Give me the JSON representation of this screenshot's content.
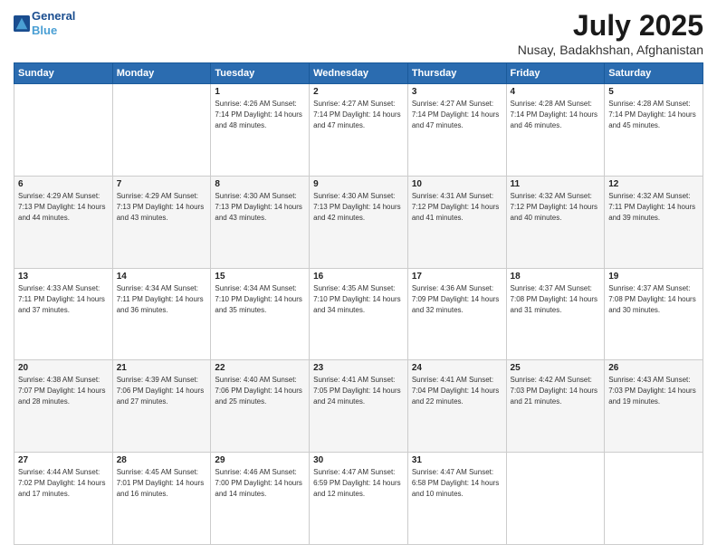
{
  "header": {
    "logo_line1": "General",
    "logo_line2": "Blue",
    "title": "July 2025",
    "subtitle": "Nusay, Badakhshan, Afghanistan"
  },
  "weekdays": [
    "Sunday",
    "Monday",
    "Tuesday",
    "Wednesday",
    "Thursday",
    "Friday",
    "Saturday"
  ],
  "weeks": [
    [
      {
        "day": "",
        "info": ""
      },
      {
        "day": "",
        "info": ""
      },
      {
        "day": "1",
        "info": "Sunrise: 4:26 AM\nSunset: 7:14 PM\nDaylight: 14 hours and 48 minutes."
      },
      {
        "day": "2",
        "info": "Sunrise: 4:27 AM\nSunset: 7:14 PM\nDaylight: 14 hours and 47 minutes."
      },
      {
        "day": "3",
        "info": "Sunrise: 4:27 AM\nSunset: 7:14 PM\nDaylight: 14 hours and 47 minutes."
      },
      {
        "day": "4",
        "info": "Sunrise: 4:28 AM\nSunset: 7:14 PM\nDaylight: 14 hours and 46 minutes."
      },
      {
        "day": "5",
        "info": "Sunrise: 4:28 AM\nSunset: 7:14 PM\nDaylight: 14 hours and 45 minutes."
      }
    ],
    [
      {
        "day": "6",
        "info": "Sunrise: 4:29 AM\nSunset: 7:13 PM\nDaylight: 14 hours and 44 minutes."
      },
      {
        "day": "7",
        "info": "Sunrise: 4:29 AM\nSunset: 7:13 PM\nDaylight: 14 hours and 43 minutes."
      },
      {
        "day": "8",
        "info": "Sunrise: 4:30 AM\nSunset: 7:13 PM\nDaylight: 14 hours and 43 minutes."
      },
      {
        "day": "9",
        "info": "Sunrise: 4:30 AM\nSunset: 7:13 PM\nDaylight: 14 hours and 42 minutes."
      },
      {
        "day": "10",
        "info": "Sunrise: 4:31 AM\nSunset: 7:12 PM\nDaylight: 14 hours and 41 minutes."
      },
      {
        "day": "11",
        "info": "Sunrise: 4:32 AM\nSunset: 7:12 PM\nDaylight: 14 hours and 40 minutes."
      },
      {
        "day": "12",
        "info": "Sunrise: 4:32 AM\nSunset: 7:11 PM\nDaylight: 14 hours and 39 minutes."
      }
    ],
    [
      {
        "day": "13",
        "info": "Sunrise: 4:33 AM\nSunset: 7:11 PM\nDaylight: 14 hours and 37 minutes."
      },
      {
        "day": "14",
        "info": "Sunrise: 4:34 AM\nSunset: 7:11 PM\nDaylight: 14 hours and 36 minutes."
      },
      {
        "day": "15",
        "info": "Sunrise: 4:34 AM\nSunset: 7:10 PM\nDaylight: 14 hours and 35 minutes."
      },
      {
        "day": "16",
        "info": "Sunrise: 4:35 AM\nSunset: 7:10 PM\nDaylight: 14 hours and 34 minutes."
      },
      {
        "day": "17",
        "info": "Sunrise: 4:36 AM\nSunset: 7:09 PM\nDaylight: 14 hours and 32 minutes."
      },
      {
        "day": "18",
        "info": "Sunrise: 4:37 AM\nSunset: 7:08 PM\nDaylight: 14 hours and 31 minutes."
      },
      {
        "day": "19",
        "info": "Sunrise: 4:37 AM\nSunset: 7:08 PM\nDaylight: 14 hours and 30 minutes."
      }
    ],
    [
      {
        "day": "20",
        "info": "Sunrise: 4:38 AM\nSunset: 7:07 PM\nDaylight: 14 hours and 28 minutes."
      },
      {
        "day": "21",
        "info": "Sunrise: 4:39 AM\nSunset: 7:06 PM\nDaylight: 14 hours and 27 minutes."
      },
      {
        "day": "22",
        "info": "Sunrise: 4:40 AM\nSunset: 7:06 PM\nDaylight: 14 hours and 25 minutes."
      },
      {
        "day": "23",
        "info": "Sunrise: 4:41 AM\nSunset: 7:05 PM\nDaylight: 14 hours and 24 minutes."
      },
      {
        "day": "24",
        "info": "Sunrise: 4:41 AM\nSunset: 7:04 PM\nDaylight: 14 hours and 22 minutes."
      },
      {
        "day": "25",
        "info": "Sunrise: 4:42 AM\nSunset: 7:03 PM\nDaylight: 14 hours and 21 minutes."
      },
      {
        "day": "26",
        "info": "Sunrise: 4:43 AM\nSunset: 7:03 PM\nDaylight: 14 hours and 19 minutes."
      }
    ],
    [
      {
        "day": "27",
        "info": "Sunrise: 4:44 AM\nSunset: 7:02 PM\nDaylight: 14 hours and 17 minutes."
      },
      {
        "day": "28",
        "info": "Sunrise: 4:45 AM\nSunset: 7:01 PM\nDaylight: 14 hours and 16 minutes."
      },
      {
        "day": "29",
        "info": "Sunrise: 4:46 AM\nSunset: 7:00 PM\nDaylight: 14 hours and 14 minutes."
      },
      {
        "day": "30",
        "info": "Sunrise: 4:47 AM\nSunset: 6:59 PM\nDaylight: 14 hours and 12 minutes."
      },
      {
        "day": "31",
        "info": "Sunrise: 4:47 AM\nSunset: 6:58 PM\nDaylight: 14 hours and 10 minutes."
      },
      {
        "day": "",
        "info": ""
      },
      {
        "day": "",
        "info": ""
      }
    ]
  ]
}
